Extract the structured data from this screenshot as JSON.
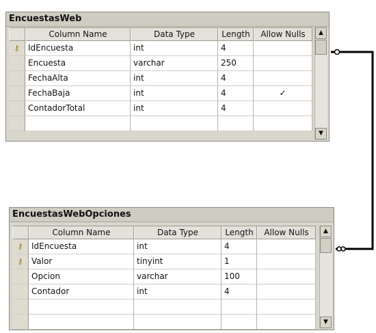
{
  "tables": [
    {
      "title": "EncuestasWeb",
      "headers": {
        "column_name": "Column Name",
        "data_type": "Data Type",
        "length": "Length",
        "allow_nulls": "Allow Nulls"
      },
      "rows": [
        {
          "key_icon": "key-icon",
          "key": "⚷",
          "name": "IdEncuesta",
          "type": "int",
          "length": "4",
          "nulls": ""
        },
        {
          "key_icon": "",
          "key": "",
          "name": "Encuesta",
          "type": "varchar",
          "length": "250",
          "nulls": ""
        },
        {
          "key_icon": "",
          "key": "",
          "name": "FechaAlta",
          "type": "int",
          "length": "4",
          "nulls": ""
        },
        {
          "key_icon": "",
          "key": "",
          "name": "FechaBaja",
          "type": "int",
          "length": "4",
          "nulls": "✓"
        },
        {
          "key_icon": "",
          "key": "",
          "name": "ContadorTotal",
          "type": "int",
          "length": "4",
          "nulls": ""
        },
        {
          "key_icon": "",
          "key": "",
          "name": "",
          "type": "",
          "length": "",
          "nulls": ""
        }
      ]
    },
    {
      "title": "EncuestasWebOpciones",
      "headers": {
        "column_name": "Column Name",
        "data_type": "Data Type",
        "length": "Length",
        "allow_nulls": "Allow Nulls"
      },
      "rows": [
        {
          "key_icon": "key-icon",
          "key": "⚷",
          "name": "IdEncuesta",
          "type": "int",
          "length": "4",
          "nulls": ""
        },
        {
          "key_icon": "key-icon",
          "key": "⚷",
          "name": "Valor",
          "type": "tinyint",
          "length": "1",
          "nulls": ""
        },
        {
          "key_icon": "",
          "key": "",
          "name": "Opcion",
          "type": "varchar",
          "length": "100",
          "nulls": ""
        },
        {
          "key_icon": "",
          "key": "",
          "name": "Contador",
          "type": "int",
          "length": "4",
          "nulls": ""
        },
        {
          "key_icon": "",
          "key": "",
          "name": "",
          "type": "",
          "length": "",
          "nulls": ""
        },
        {
          "key_icon": "",
          "key": "",
          "name": "",
          "type": "",
          "length": "",
          "nulls": ""
        }
      ]
    }
  ],
  "scrollbar": {
    "up_icon": "▲",
    "down_icon": "▼"
  },
  "relationship": {
    "one_end": "key-end",
    "many_end": "infinity-end"
  }
}
